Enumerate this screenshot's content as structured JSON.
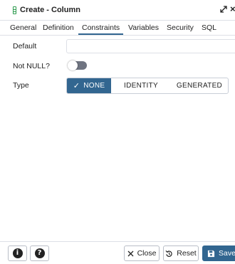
{
  "dialog": {
    "title": "Create - Column",
    "close_glyph": "×"
  },
  "tabs": [
    {
      "label": "General",
      "active": false
    },
    {
      "label": "Definition",
      "active": false
    },
    {
      "label": "Constraints",
      "active": true
    },
    {
      "label": "Variables",
      "active": false
    },
    {
      "label": "Security",
      "active": false
    },
    {
      "label": "SQL",
      "active": false
    }
  ],
  "form": {
    "default": {
      "label": "Default",
      "value": "",
      "placeholder": ""
    },
    "not_null": {
      "label": "Not NULL?",
      "checked": false
    },
    "type": {
      "label": "Type",
      "options": [
        "NONE",
        "IDENTITY",
        "GENERATED"
      ],
      "selected": "NONE"
    }
  },
  "footer": {
    "info_glyph": "i",
    "help_glyph": "?",
    "close_label": "Close",
    "reset_label": "Reset",
    "save_label": "Save"
  },
  "colors": {
    "accent": "#326690",
    "toggle_off": "#6f7481",
    "column_icon": "#2e9b4f"
  },
  "icons": [
    "column-icon",
    "expand-icon",
    "close-icon",
    "check-icon",
    "info-icon",
    "help-icon",
    "close-x-icon",
    "reset-icon",
    "save-icon"
  ]
}
